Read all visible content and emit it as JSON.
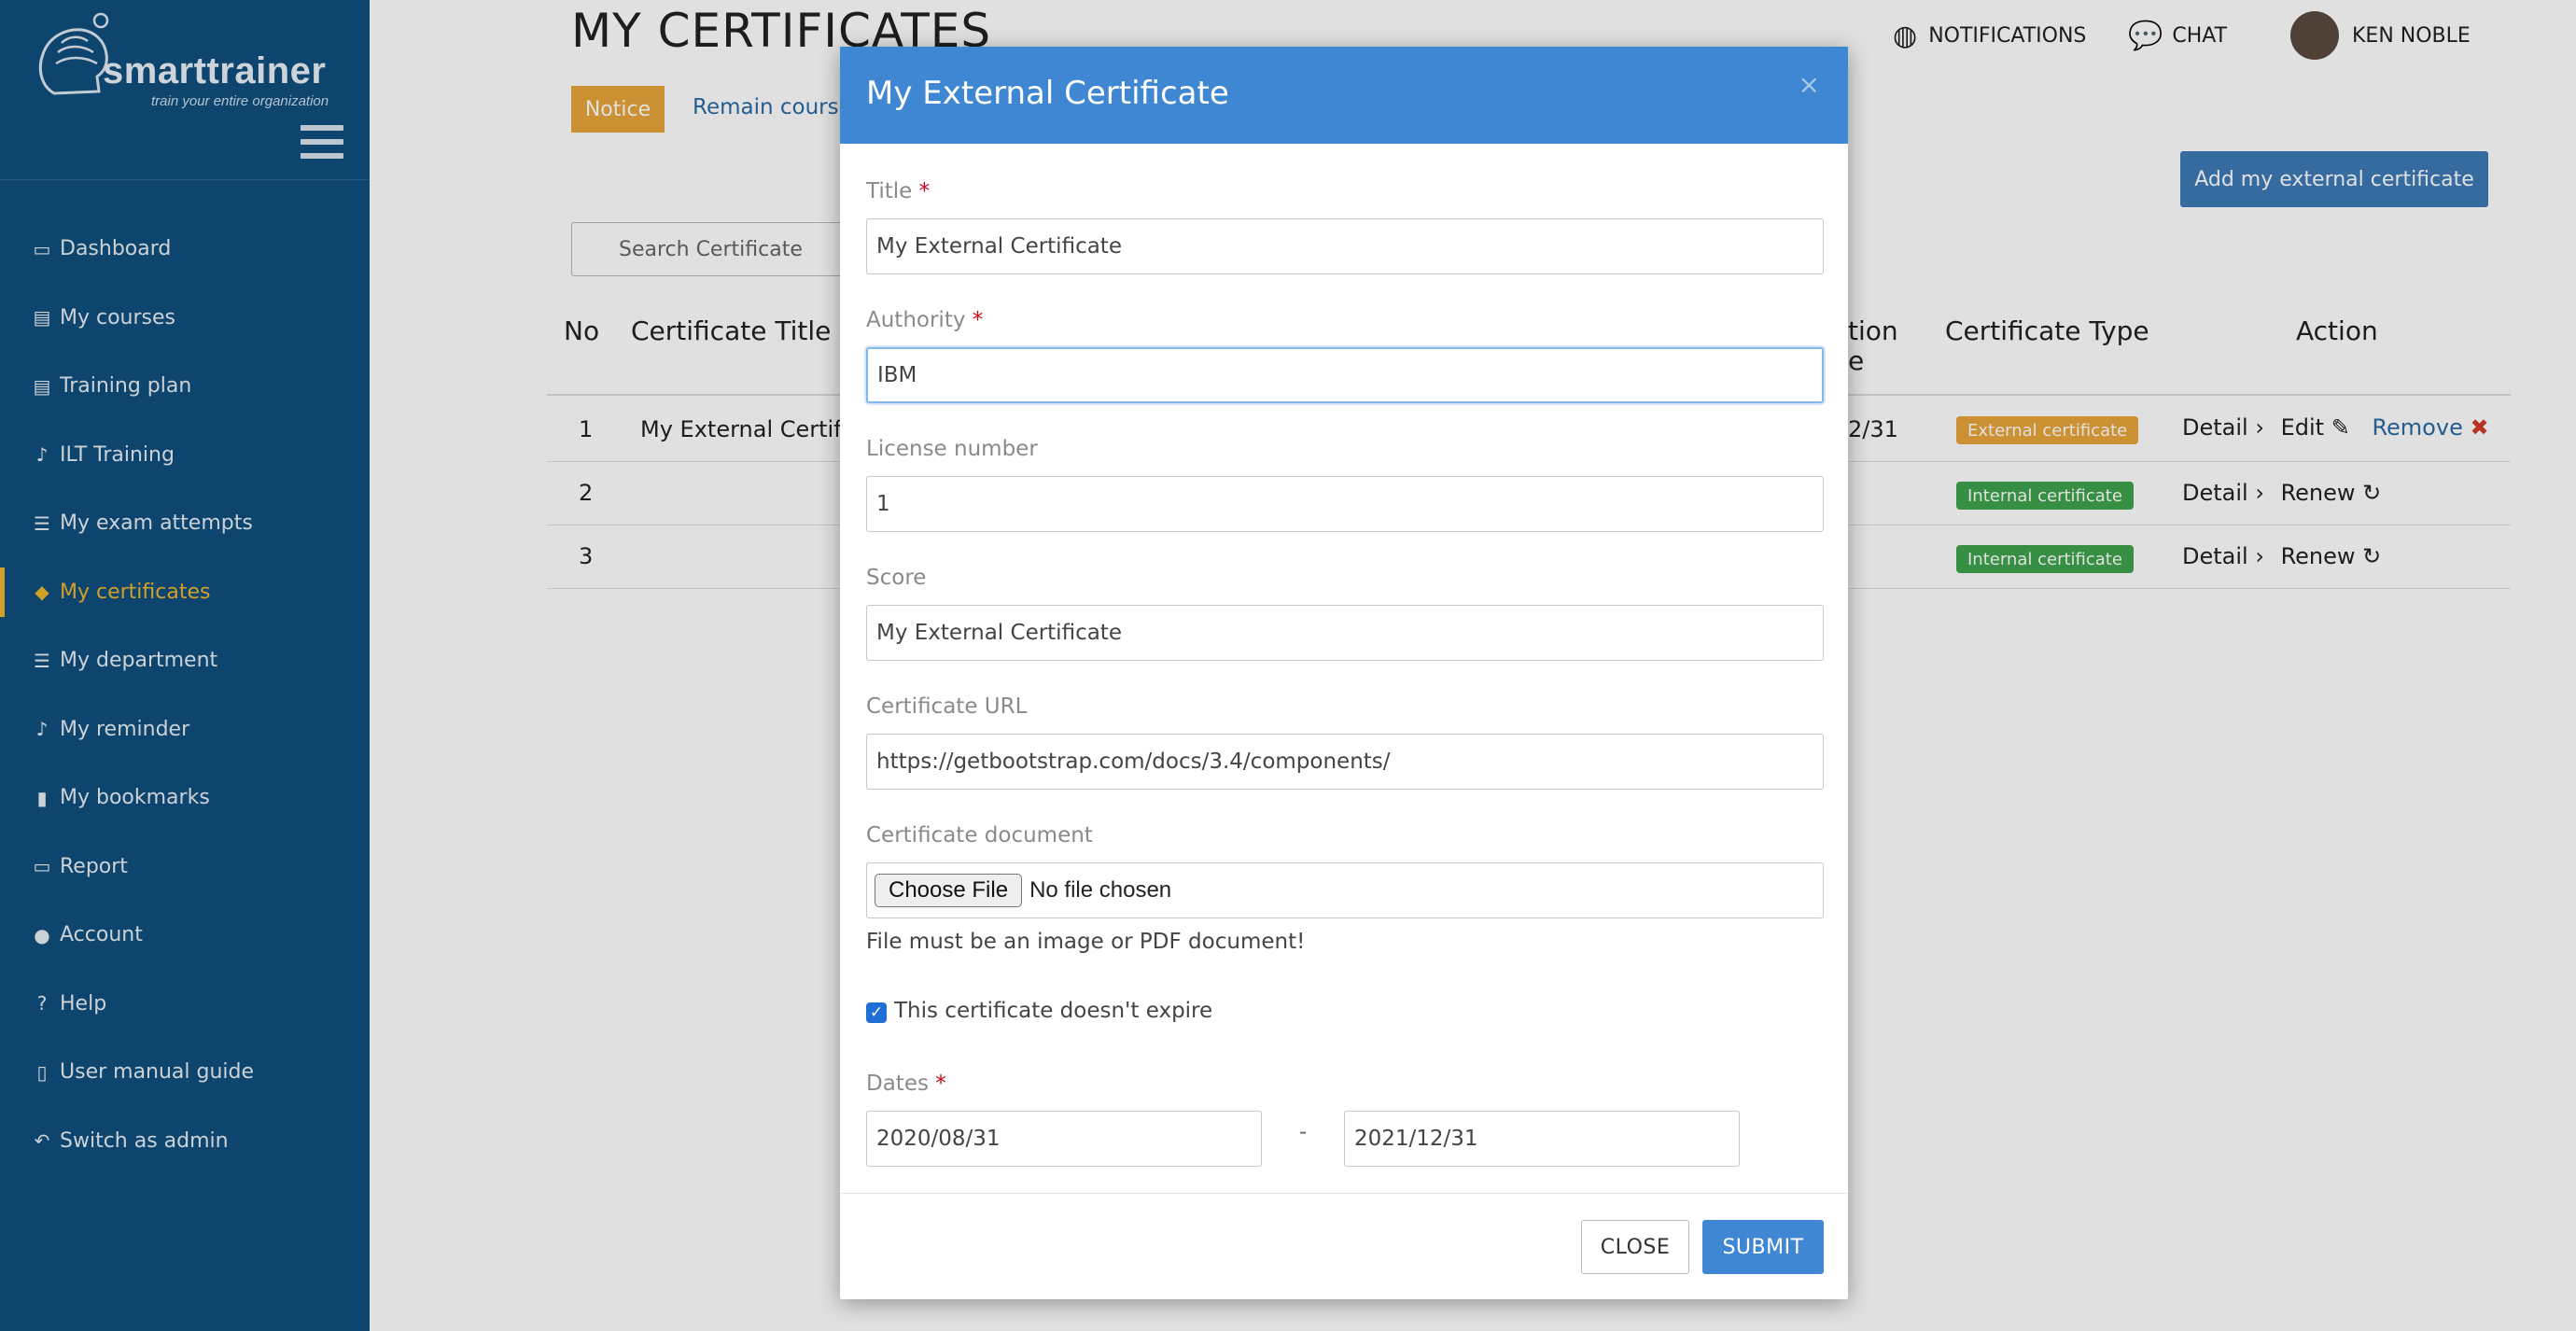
{
  "brand": {
    "name": "smarttrainer",
    "tagline": "train your entire organization"
  },
  "sidebar": {
    "items": [
      {
        "label": "Dashboard",
        "icon": "monitor-icon"
      },
      {
        "label": "My courses",
        "icon": "book-icon"
      },
      {
        "label": "Training plan",
        "icon": "book-icon"
      },
      {
        "label": "ILT Training",
        "icon": "bell-icon"
      },
      {
        "label": "My exam attempts",
        "icon": "list-icon"
      },
      {
        "label": "My certificates",
        "icon": "graduation-cap-icon",
        "active": true
      },
      {
        "label": "My department",
        "icon": "list-icon"
      },
      {
        "label": "My reminder",
        "icon": "bell-icon"
      },
      {
        "label": "My bookmarks",
        "icon": "bookmark-icon"
      },
      {
        "label": "Report",
        "icon": "monitor-icon"
      },
      {
        "label": "Account",
        "icon": "user-icon"
      },
      {
        "label": "Help",
        "icon": "question-circle-icon"
      },
      {
        "label": "User manual guide",
        "icon": "file-icon"
      },
      {
        "label": "Switch as admin",
        "icon": "reply-icon"
      }
    ]
  },
  "header": {
    "title": "MY CERTIFICATES",
    "notifications": "NOTIFICATIONS",
    "chat": "CHAT",
    "user": "KEN NOBLE"
  },
  "main": {
    "notice": "Notice",
    "remain_link": "Remain course",
    "add_button": "Add my external certificate",
    "search_placeholder": "Search Certificate",
    "table": {
      "columns": {
        "no": "No",
        "title": "Certificate Title",
        "expiration_a": "tion",
        "expiration_b": "e",
        "type": "Certificate Type",
        "action": "Action"
      },
      "rows": [
        {
          "no": "1",
          "title": "My External Certific",
          "date": "2/31",
          "type": "External certificate",
          "kind": "ext",
          "detail": "Detail",
          "op": "Edit",
          "remove": "Remove"
        },
        {
          "no": "2",
          "title": "",
          "date": "",
          "type": "Internal certificate",
          "kind": "int",
          "detail": "Detail",
          "op": "Renew"
        },
        {
          "no": "3",
          "title": "",
          "date": "",
          "type": "Internal certificate",
          "kind": "int",
          "detail": "Detail",
          "op": "Renew"
        }
      ]
    }
  },
  "modal": {
    "title": "My External Certificate",
    "close_x": "×",
    "fields": {
      "title_label": "Title",
      "title_value": "My External Certificate",
      "authority_label": "Authority",
      "authority_value": "IBM",
      "license_label": "License number",
      "license_value": "1",
      "score_label": "Score",
      "score_value": "My External Certificate",
      "url_label": "Certificate URL",
      "url_value": "https://getbootstrap.com/docs/3.4/components/",
      "document_label": "Certificate document",
      "choose_file": "Choose File",
      "no_file": "No file chosen",
      "file_help": "File must be an image or PDF document!",
      "no_expire": "This certificate doesn't expire",
      "no_expire_checked": true,
      "dates_label": "Dates",
      "date_from": "2020/08/31",
      "date_sep": "-",
      "date_to": "2021/12/31"
    },
    "close_button": "CLOSE",
    "submit_button": "SUBMIT"
  },
  "colors": {
    "sidebar": "#0f4f7e",
    "accent": "#3f87d2",
    "active": "#f0b72f",
    "notice": "#e9a53b",
    "internal": "#3fa34d",
    "remove": "#d23b2a"
  }
}
